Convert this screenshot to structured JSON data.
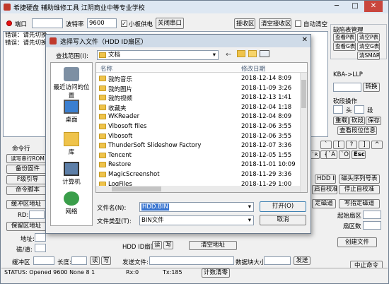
{
  "app": {
    "title": "希捷硬盘 辅助维修工具    江阴商业中等专业学校",
    "minimize": "─",
    "maximize": "□",
    "close": "✕"
  },
  "top": {
    "port_label": "端口",
    "baud_label": "波特率",
    "baud_value": "9600",
    "small_board_power": "小板供电",
    "close_port": "关闭串口",
    "recv_zone": "接收区",
    "clear_recv": "清空接收区",
    "auto_clear": "自动清空"
  },
  "log": {
    "lines": [
      "错误：请先切换",
      "错误：请先切换"
    ]
  },
  "right_panel": {
    "defect_mgmt": "缺陷表管理",
    "view_p": "查看P表",
    "clear_p": "清空P表",
    "view_g": "查看G表",
    "clear_g": "清空G表",
    "clear_smart": "清SMART",
    "lba_llp": "KBA->LLP",
    "convert": "转换",
    "soft_ops": "砍段操作",
    "head": "头",
    "seg": "段",
    "rezero": "重载",
    "soft_seg": "砍段",
    "save": "保存",
    "view_seg_info": "查看段位信息",
    "keys": [
      "`",
      "[",
      "?",
      "]",
      "^",
      "{",
      "}",
      "A",
      "O",
      "Esc"
    ],
    "key_row2": [
      "`R",
      "`A",
      "`O",
      "Esc"
    ],
    "hdd_id": "HDD ID",
    "head_seq": "磁头序列号表",
    "start_check": "启自校准",
    "stop_check": "停止自校准",
    "set_track": "定磁道",
    "write_track": "写指定磁道",
    "start_sector": "起始扇区",
    "sector_count": "扇区数",
    "create_file": "创建文件",
    "stop_cmd": "中止命令"
  },
  "left_panel": {
    "cmd_line": "命令行",
    "read_rom": "读写串行ROM",
    "backup_fw": "备份固件",
    "f_guide": "F级引导",
    "cmd_script": "命令脚本",
    "buffer_addr": "缓冲区地址",
    "rd": "RD:",
    "keep_buffer": "保留区地址",
    "addr": "地址:",
    "head_track": "磁/道:",
    "buffer": "缓冲区",
    "length": "长度:",
    "read": "读",
    "write": "写"
  },
  "bottom": {
    "hdd_id_sector": "HDD ID扇区",
    "read": "读",
    "write": "写",
    "clear_addr": "清空地址",
    "send_file": "发送文件:",
    "block_size": "数据块大小:",
    "send": "发送",
    "status_text": "STATUS:   Opened 9600 None 8 1",
    "rx": "Rx:0",
    "tx": "Tx:185",
    "count_clear": "计数清零"
  },
  "dialog": {
    "title": "选择写入文件（HDD ID扇区）",
    "lookin_label": "查找范围(I):",
    "lookin_value": "文档",
    "col_name": "名称",
    "col_date": "修改日期",
    "places": [
      {
        "label": "最近访问的位置",
        "icon": "recent-icon"
      },
      {
        "label": "桌面",
        "icon": "desktop-icon"
      },
      {
        "label": "库",
        "icon": "library-icon"
      },
      {
        "label": "计算机",
        "icon": "computer-icon"
      },
      {
        "label": "网络",
        "icon": "network-icon"
      }
    ],
    "files": [
      {
        "name": "我的音乐",
        "date": "2018-12-14  8:09"
      },
      {
        "name": "我的图片",
        "date": "2018-11-09  3:26"
      },
      {
        "name": "我的视频",
        "date": "2018-12-13  1:41"
      },
      {
        "name": "收藏夹",
        "date": "2018-12-04  1:18"
      },
      {
        "name": "WKReader",
        "date": "2018-12-04  8:09"
      },
      {
        "name": "Vibosoft files",
        "date": "2018-12-06  3:55"
      },
      {
        "name": "Vibosoft",
        "date": "2018-12-06  3:55"
      },
      {
        "name": "ThunderSoft Slideshow Factory",
        "date": "2018-12-07  3:36"
      },
      {
        "name": "Tencent",
        "date": "2018-12-05  1:55"
      },
      {
        "name": "Restore",
        "date": "2018-11-01  10:09"
      },
      {
        "name": "MagicScreenshot",
        "date": "2018-11-29  3:36"
      },
      {
        "name": "LogFiles",
        "date": "2018-11-29  1:00"
      }
    ],
    "filename_label": "文件名(N):",
    "filename_value": "HDD.BIN",
    "filetype_label": "文件类型(T):",
    "filetype_value": "BIN文件",
    "open_btn": "打开(O)",
    "cancel_btn": "取消"
  },
  "colors": {
    "title_bar": "#dde7f2",
    "folder": "#efc34b",
    "selected_text": "#1f5fbf",
    "led": "#e81010"
  }
}
